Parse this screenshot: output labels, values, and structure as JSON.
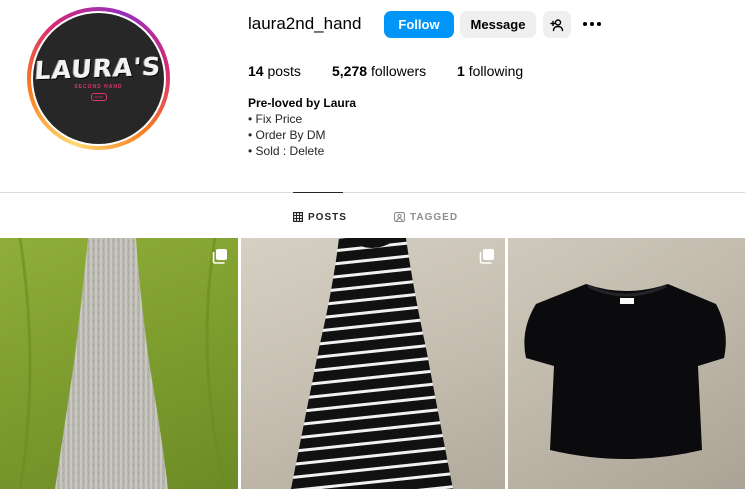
{
  "profile": {
    "username": "laura2nd_hand",
    "avatar": {
      "logo_text": "LAURA'S",
      "logo_subtext": "SECOND HAND",
      "logo_badge": "SHOP",
      "ring_colors": [
        "#feda75",
        "#fa7e1e",
        "#d62976",
        "#962fbf"
      ]
    }
  },
  "actions": {
    "follow_label": "Follow",
    "message_label": "Message",
    "suggest_icon": "person-plus-icon",
    "more_icon": "more-horizontal-icon",
    "follow_color": "#0095f6"
  },
  "stats": {
    "posts_count": "14",
    "posts_label": "posts",
    "followers_count": "5,278",
    "followers_label": "followers",
    "following_count": "1",
    "following_label": "following"
  },
  "bio": {
    "name": "Pre-loved by Laura",
    "lines": [
      "• Fix Price",
      "• Order By DM",
      "• Sold : Delete"
    ]
  },
  "tabs": [
    {
      "label": "POSTS",
      "icon": "grid-icon",
      "active": true
    },
    {
      "label": "TAGGED",
      "icon": "tagged-icon",
      "active": false
    }
  ],
  "posts": [
    {
      "subject": "grey ribbed knit maxi dress on green sheet",
      "multi": true
    },
    {
      "subject": "black and white striped maxi dress",
      "multi": true
    },
    {
      "subject": "black short sleeve knit top",
      "multi": false
    }
  ]
}
